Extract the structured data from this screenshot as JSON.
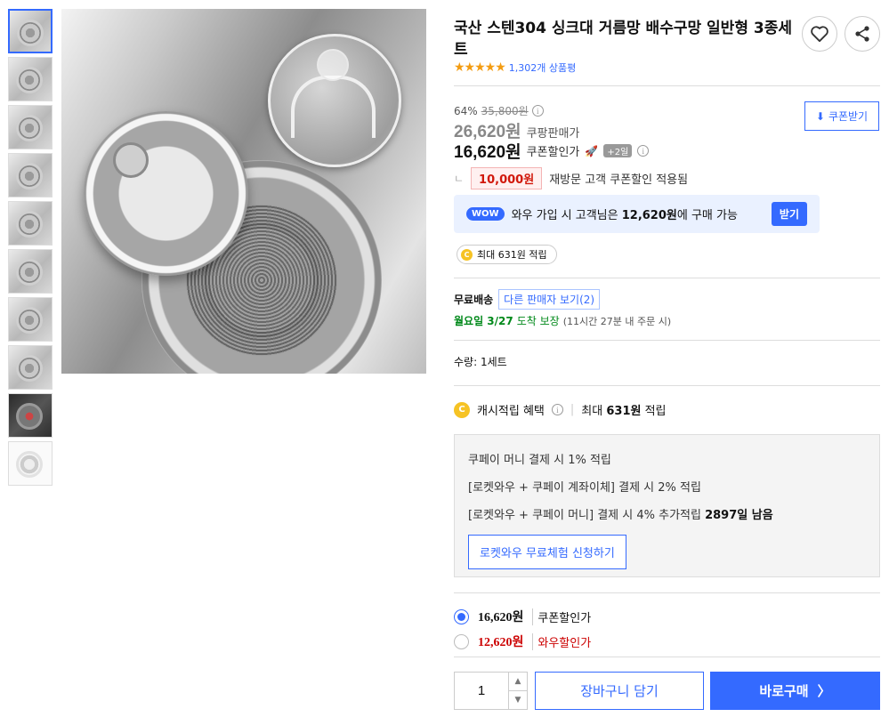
{
  "product": {
    "title": "국산 스텐304 싱크대 거름망 배수구망 일반형 3종세트",
    "rating": {
      "stars_value": 4.5,
      "stars_glyphs": "★★★★★",
      "review_count": "1,302개 상품평"
    }
  },
  "icons": {
    "like": "heart-icon",
    "share": "share-icon",
    "info": "i",
    "coupon_download": "⬇"
  },
  "pricing": {
    "discount_rate": "64%",
    "original_price": "35,800원",
    "sale_price": "26,620원",
    "sale_label": "쿠팡판매가",
    "coupon_price": "16,620원",
    "coupon_label": "쿠폰할인가",
    "rocket": "🚀",
    "plus_badge": "+2일",
    "coupon_button": "쿠폰받기"
  },
  "revisit": {
    "corner": "ㄴ",
    "amount": "10,000원",
    "text": "재방문 고객 쿠폰할인 적용됨"
  },
  "wow": {
    "badge": "WOW",
    "text_before": "와우 가입 시 고객님은 ",
    "price": "12,620원",
    "text_after": "에 구매 가능",
    "button": "받기"
  },
  "cash_pill": {
    "coin": "C",
    "text": "최대 631원 적립"
  },
  "shipping": {
    "free": "무료배송",
    "other_seller": "다른 판매자 보기(2)",
    "arrival_day": "월요일 3/27",
    "arrival_suffix": "도착 보장",
    "arrival_note": "(11시간 27분 내 주문 시)"
  },
  "quantity_line": {
    "label": "수량:",
    "value": "1세트"
  },
  "benefit": {
    "coin": "C",
    "label": "캐시적립 혜택",
    "max_prefix": "최대 ",
    "max_value": "631원",
    "max_suffix": " 적립"
  },
  "cashbox": {
    "row1": "쿠페이 머니 결제 시 1% 적립",
    "row2": "[로켓와우 + 쿠페이 계좌이체] 결제 시 2% 적립",
    "row3_text": "[로켓와우 + 쿠페이 머니] 결제 시 4% 추가적립 ",
    "row3_bold": "2897일 남음",
    "trial_button": "로켓와우 무료체험 신청하기"
  },
  "options": [
    {
      "price": "16,620원",
      "label": "쿠폰할인가",
      "selected": true
    },
    {
      "price": "12,620원",
      "label": "와우할인가",
      "selected": false
    }
  ],
  "purchase": {
    "quantity": "1",
    "up": "▲",
    "down": "▼",
    "cart_button": "장바구니 담기",
    "buy_button": "바로구매",
    "buy_arrow": "〉"
  },
  "colors": {
    "accent": "#346aff",
    "sale_red": "#d1180b",
    "arrival_green": "#00891a",
    "star": "#f39c12"
  }
}
